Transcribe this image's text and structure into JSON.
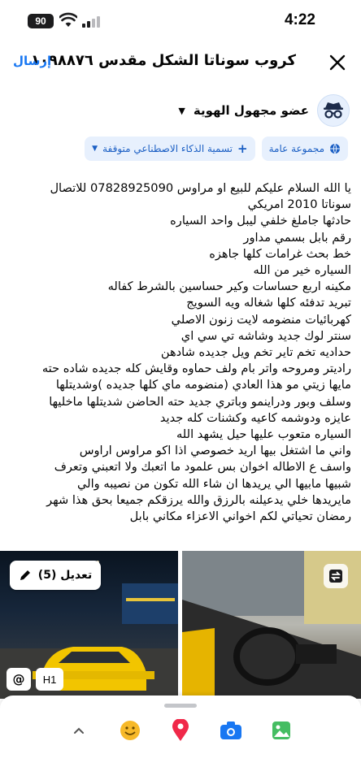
{
  "status_bar": {
    "time": "4:22",
    "battery": "90"
  },
  "header": {
    "title": "كروب سوناتا الشكل مقدس ١٠٩٨٨٧٦",
    "send_label": "إرسال"
  },
  "composer": {
    "author_name": "عضو مجهول الهوية",
    "chips": {
      "audience": "مجموعة عامة",
      "ai_label": "تسمية الذكاء الاصطناعي متوقفة"
    }
  },
  "post": {
    "lines": [
      "يا الله السلام عليكم للبيع او مراوس 07828925090 للاتصال",
      "سوناتا 2010 امريكي",
      "حادثها جاملغ خلفي ليبل واحد السياره",
      "رقم بابل بسمي مداور",
      "خط بحث غرامات كلها جاهزه",
      "السياره خير من الله",
      "مكينه اربع حساسات وكير حساسين  بالشرط كفاله",
      "تبريد تدفئه كلها شغاله ويه السويج",
      "كهربائيات منضومه لايت زنون الاصلي",
      "سنتر لوك جديد وشاشه تي سي اي",
      " حداديه تخم تاير تخم ويل جديده شادهن",
      "راديتر ومروحه واتر بام ولف حماوه وقايش كله جديده شاده حته",
      "مايها زيتي مو هذا العادي (منضومه ماي كلها جديده )وشديتلها",
      "وسلف وبور ودراينمو وباتري جديد حته الحاضن شديتلها ماخليها",
      "عايزه ودوشمه كاعيه وكشنات كله جديد",
      "السياره متعوب عليها حيل يشهد الله",
      "واني ما اشتغل بيها اريد خصوصي اذا اكو مراوس اراوس",
      "واسف ع الاطاله اخوان بس علمود ما اتعبك ولا اتعبني وتعرف",
      "شبيها مابيها الي يريدها ان شاء الله تكون من نصيبه والي",
      "مايريدها خلي يدعيلنه بالرزق والله يرزقكم جميعا بحق هذا شهر",
      "رمضان تحياتي لكم اخواني الاعزاء مكاني بابل"
    ]
  },
  "media": {
    "edit_label": "تعديل (5)",
    "at_label": "@",
    "h1_label": "H1"
  },
  "colors": {
    "accent": "#1877f2",
    "chip_bg": "#e7f0fd",
    "chip_text": "#1b5fc4",
    "car_yellow": "#f2c500"
  },
  "toolbar_icons": [
    "chevron-up-icon",
    "emoji-icon",
    "location-pin-icon",
    "camera-icon",
    "photo-icon"
  ]
}
